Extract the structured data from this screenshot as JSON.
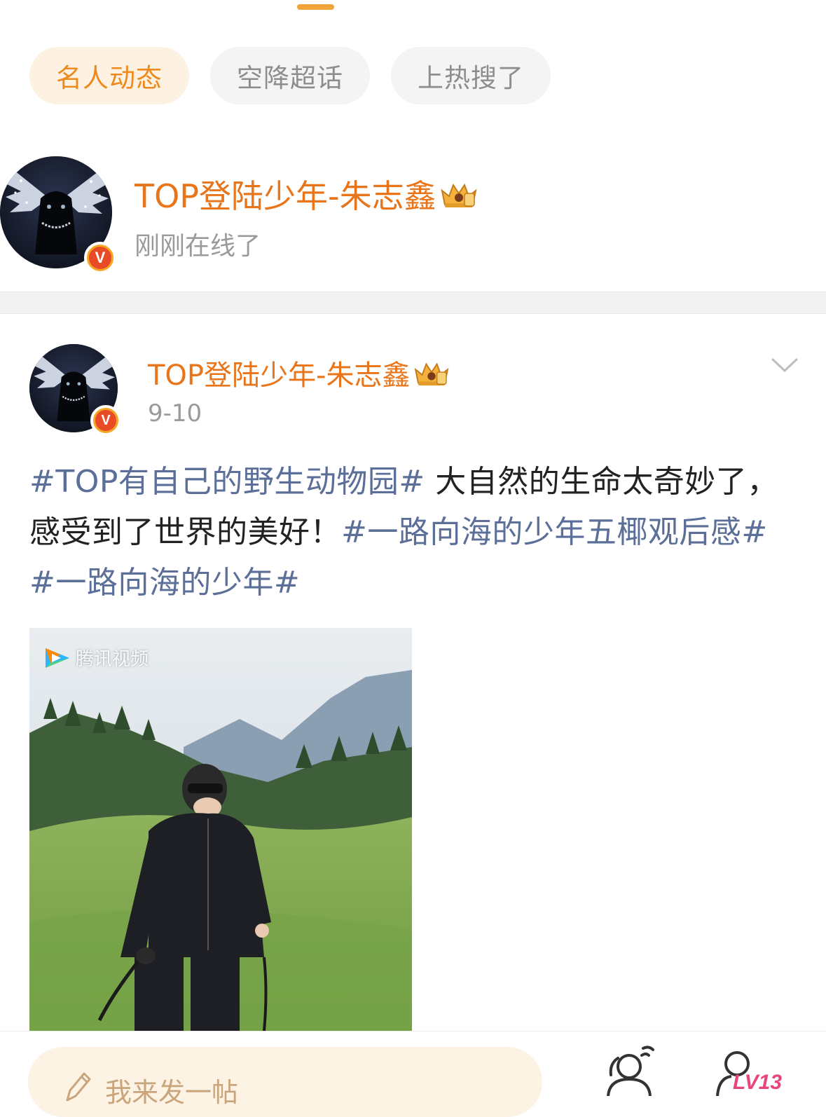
{
  "tabs": [
    {
      "label": "名人动态",
      "active": true
    },
    {
      "label": "空降超话",
      "active": false
    },
    {
      "label": "上热搜了",
      "active": false
    }
  ],
  "online_celebrity": {
    "name": "TOP登陆少年-朱志鑫",
    "status": "刚刚在线了",
    "verified_badge": "V"
  },
  "post": {
    "author": "TOP登陆少年-朱志鑫",
    "date": "9-10",
    "verified_badge": "V",
    "text_segments": [
      {
        "text": "#TOP有自己的野生动物园#",
        "type": "tag"
      },
      {
        "text": " 大自然的生命太奇妙了，感受到了世界的美好！",
        "type": "plain"
      },
      {
        "text": "#一路向海的少年五椰观后感#",
        "type": "tag"
      },
      {
        "text": " ",
        "type": "plain"
      },
      {
        "text": "#一路向海的少年#",
        "type": "tag"
      }
    ],
    "image_watermark": "腾讯视频"
  },
  "bottom_bar": {
    "compose_placeholder": "我来发一帖",
    "level_badge": "LV13"
  },
  "colors": {
    "accent_orange": "#e8751a",
    "tab_active_bg": "#fdf1e1",
    "tag_blue": "#5b6f98",
    "level_pink": "#e8457a"
  },
  "icons": [
    "crown-badge-icon",
    "verified-v-icon",
    "chevron-down-icon",
    "pen-icon",
    "people-icon",
    "level-badge-icon",
    "tencent-video-logo-icon"
  ]
}
